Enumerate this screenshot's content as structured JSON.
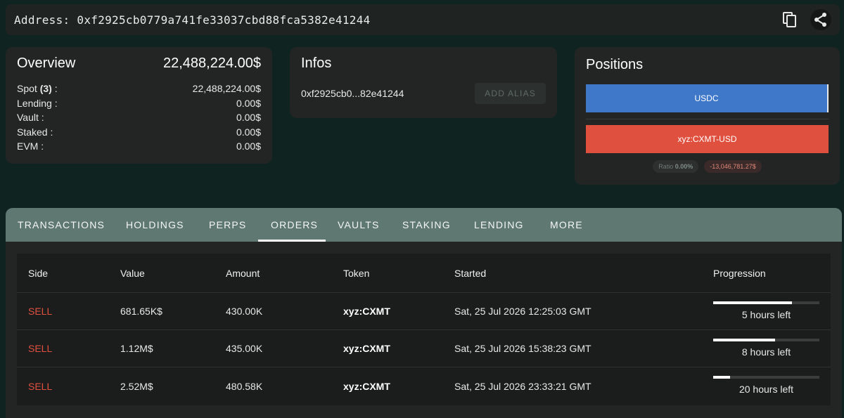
{
  "address_bar": {
    "label": "Address: 0xf2925cb0779a741fe33037cbd88fca5382e41244",
    "copy_icon": "copy-icon",
    "share_icon": "share-icon"
  },
  "overview": {
    "title": "Overview",
    "total": "22,488,224.00$",
    "rows": [
      {
        "label": "Spot",
        "count": "(3)",
        "suffix": " :",
        "value": "22,488,224.00$"
      },
      {
        "label": "Lending :",
        "value": "0.00$"
      },
      {
        "label": "Vault :",
        "value": "0.00$"
      },
      {
        "label": "Staked :",
        "value": "0.00$"
      },
      {
        "label": "EVM :",
        "value": "0.00$"
      }
    ]
  },
  "infos": {
    "title": "Infos",
    "short_address": "0xf2925cb0...82e41244",
    "alias_button": "ADD ALIAS"
  },
  "positions": {
    "title": "Positions",
    "long_label": "USDC",
    "short_label": "xyz:CXMT-USD",
    "ratio_label": "Ratio",
    "ratio_value": "0.00%",
    "pnl": "-13,046,781.27$",
    "colors": {
      "long": "#3f78c9",
      "short": "#e0503f"
    }
  },
  "tabs": {
    "items": [
      "TRANSACTIONS",
      "HOLDINGS",
      "PERPS",
      "ORDERS",
      "VAULTS",
      "STAKING",
      "LENDING",
      "MORE"
    ],
    "active": "ORDERS"
  },
  "orders_table": {
    "headers": [
      "Side",
      "Value",
      "Amount",
      "Token",
      "Started",
      "Progression"
    ],
    "rows": [
      {
        "side": "SELL",
        "value": "681.65K$",
        "amount": "430.00K",
        "token": "xyz:CXMT",
        "started": "Sat, 25 Jul 2026 12:25:03 GMT",
        "progress": 0.74,
        "remaining": "5 hours left"
      },
      {
        "side": "SELL",
        "value": "1.12M$",
        "amount": "435.00K",
        "token": "xyz:CXMT",
        "started": "Sat, 25 Jul 2026 15:38:23 GMT",
        "progress": 0.58,
        "remaining": "8 hours left"
      },
      {
        "side": "SELL",
        "value": "2.52M$",
        "amount": "480.58K",
        "token": "xyz:CXMT",
        "started": "Sat, 25 Jul 2026 23:33:21 GMT",
        "progress": 0.16,
        "remaining": "20 hours left"
      }
    ],
    "sell_color": "#e0503f"
  }
}
